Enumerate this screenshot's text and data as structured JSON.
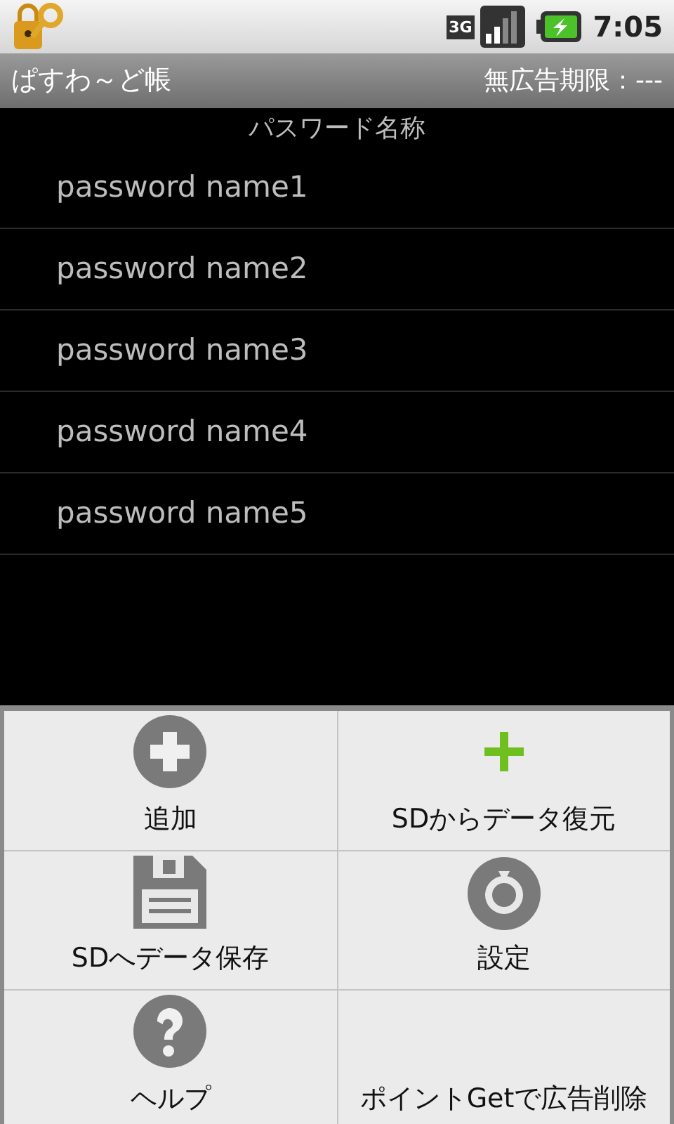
{
  "status_bar": {
    "network": "3G",
    "time": "7:05"
  },
  "title_bar": {
    "title": "ぱすわ～ど帳",
    "ad_free": "無広告期限：---"
  },
  "list": {
    "header": "パスワード名称",
    "items": [
      {
        "label": "password name1"
      },
      {
        "label": "password name2"
      },
      {
        "label": "password name3"
      },
      {
        "label": "password name4"
      },
      {
        "label": "password name5"
      }
    ]
  },
  "menu": [
    {
      "kind": "add",
      "label": "追加"
    },
    {
      "kind": "restore",
      "label": "SDからデータ復元"
    },
    {
      "kind": "save",
      "label": "SDへデータ保存"
    },
    {
      "kind": "settings",
      "label": "設定"
    },
    {
      "kind": "help",
      "label": "ヘルプ"
    },
    {
      "kind": "text",
      "label": "ポイントGetで広告削除"
    }
  ]
}
